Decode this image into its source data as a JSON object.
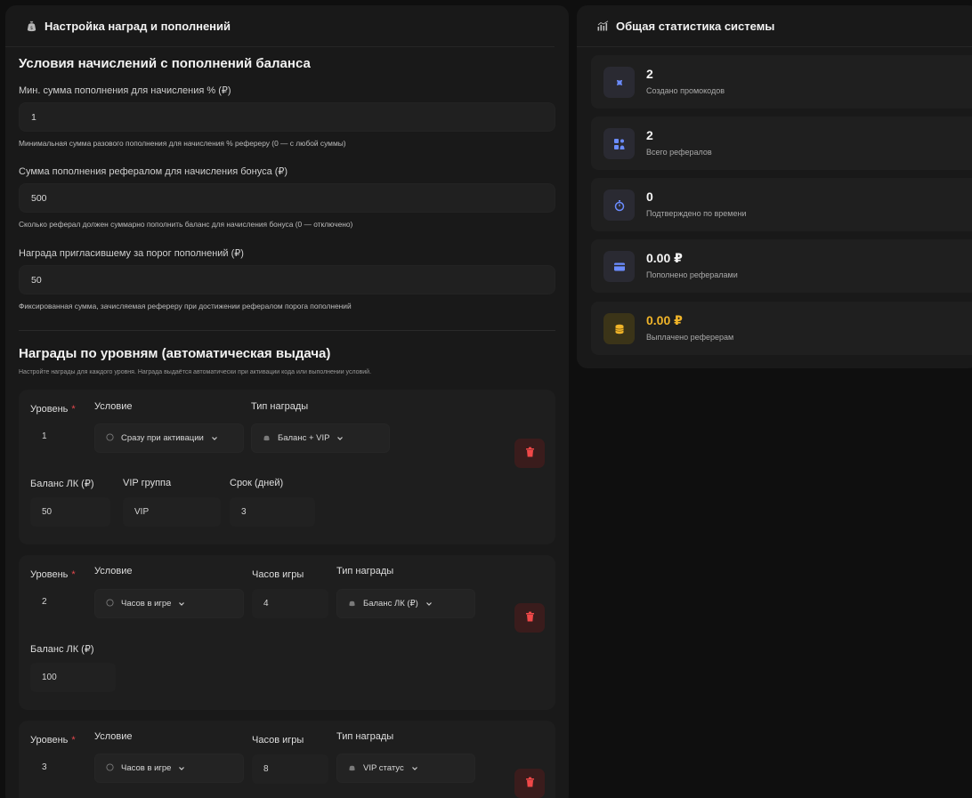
{
  "left_panel": {
    "title": "Настройка наград и пополнений",
    "topup_section": {
      "title": "Условия начислений с пополнений баланса",
      "fields": [
        {
          "label": "Мин. сумма пополнения для начисления % (₽)",
          "value": "1",
          "hint": "Минимальная сумма разового пополнения для начисления % рефереру (0 — с любой суммы)"
        },
        {
          "label": "Сумма пополнения рефералом для начисления бонуса (₽)",
          "value": "500",
          "hint": "Сколько реферал должен суммарно пополнить баланс для начисления бонуса (0 — отключено)"
        },
        {
          "label": "Награда пригласившему за порог пополнений (₽)",
          "value": "50",
          "hint": "Фиксированная сумма, зачисляемая рефереру при достижении рефералом порога пополнений"
        }
      ]
    },
    "levels_section": {
      "title": "Награды по уровням (автоматическая выдача)",
      "hint": "Настройте награды для каждого уровня. Награда выдаётся автоматически при активации кода или выполнении условий.",
      "labels": {
        "level": "Уровень",
        "required_mark": "*",
        "condition": "Условие",
        "reward_type": "Тип награды",
        "balance": "Баланс ЛК (₽)",
        "vip_group": "VIP группа",
        "duration": "Срок (дней)",
        "hours": "Часов игры"
      },
      "levels": [
        {
          "level": "1",
          "condition": "Сразу при активации",
          "reward_type": "Баланс + VIP",
          "balance": "50",
          "vip_group": "VIP",
          "duration": "3"
        },
        {
          "level": "2",
          "condition": "Часов в игре",
          "hours": "4",
          "reward_type": "Баланс ЛК (₽)",
          "balance": "100"
        },
        {
          "level": "3",
          "condition": "Часов в игре",
          "hours": "8",
          "reward_type": "VIP статус"
        }
      ]
    }
  },
  "right_panel": {
    "title": "Общая статистика системы",
    "stats": [
      {
        "value": "2",
        "label": "Создано промокодов",
        "icon": "ticket-icon",
        "color": "#6b8cff"
      },
      {
        "value": "2",
        "label": "Всего рефералов",
        "icon": "users-icon",
        "color": "#6b8cff"
      },
      {
        "value": "0",
        "label": "Подтверждено по времени",
        "icon": "stopwatch-icon",
        "color": "#6b8cff"
      },
      {
        "value": "0.00 ₽",
        "label": "Пополнено рефералами",
        "icon": "credit-card-icon",
        "color": "#6b8cff"
      },
      {
        "value": "0.00 ₽",
        "label": "Выплачено реферерам",
        "icon": "coins-icon",
        "color": "#f0b429"
      }
    ]
  }
}
